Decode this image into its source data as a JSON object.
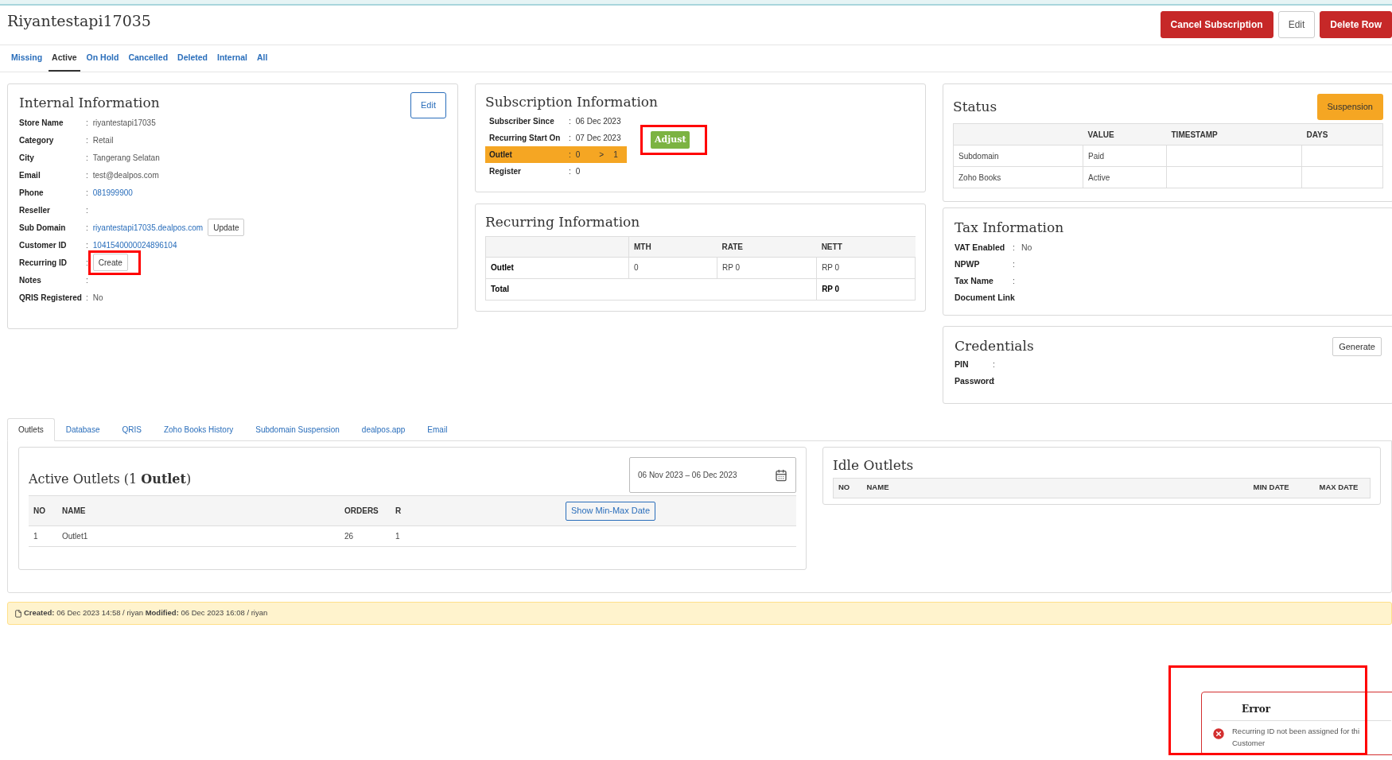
{
  "page": {
    "title": "Riyantestapi17035",
    "actions": [
      {
        "label": "Cancel Subscription",
        "kind": "danger"
      },
      {
        "label": "Edit",
        "kind": "outline"
      },
      {
        "label": "Delete Row",
        "kind": "danger"
      }
    ]
  },
  "filter_tabs": [
    {
      "label": "Missing",
      "selected": false
    },
    {
      "label": "Active",
      "selected": true
    },
    {
      "label": "On Hold",
      "selected": false
    },
    {
      "label": "Cancelled",
      "selected": false
    },
    {
      "label": "Deleted",
      "selected": false
    },
    {
      "label": "Internal",
      "selected": false
    },
    {
      "label": "All",
      "selected": false
    }
  ],
  "internal_information": {
    "title": "Internal Information",
    "edit_button": "Edit",
    "fields": [
      {
        "label": "Store Name",
        "sep": ":",
        "value": "riyantestapi17035",
        "kind": "text"
      },
      {
        "label": "Category",
        "sep": ":",
        "value": "Retail",
        "kind": "text"
      },
      {
        "label": "City",
        "sep": ":",
        "value": "Tangerang Selatan",
        "kind": "text"
      },
      {
        "label": "Email",
        "sep": ":",
        "value": "test@dealpos.com",
        "kind": "text"
      },
      {
        "label": "Phone",
        "sep": ":",
        "value": "081999900",
        "kind": "link"
      },
      {
        "label": "Reseller",
        "sep": ":"
      },
      {
        "label": "Sub Domain",
        "sep": ":",
        "value": "riyantestapi17035.dealpos.com",
        "kind": "link",
        "button": "Update"
      },
      {
        "label": "Customer ID",
        "sep": ":",
        "value": "1041540000024896104",
        "kind": "link"
      },
      {
        "label": "Recurring ID",
        "sep": ":",
        "kind": "button",
        "button": "Create",
        "annotated": true
      },
      {
        "label": "Notes",
        "sep": ":"
      },
      {
        "label": "QRIS Registered",
        "sep": ":",
        "value": "No",
        "kind": "text"
      }
    ]
  },
  "subscription_information": {
    "title": "Subscription Information",
    "fields": [
      {
        "label": "Subscriber Since",
        "sep": ":",
        "value": "06 Dec 2023",
        "highlighted": false
      },
      {
        "label": "Recurring Start On",
        "sep": ":",
        "value": "07 Dec 2023",
        "highlighted": false
      },
      {
        "label": "Outlet",
        "sep": ":",
        "value": "0",
        "arrow": ">",
        "target": "1",
        "highlighted": true
      },
      {
        "label": "Register",
        "sep": ":",
        "value": "0",
        "highlighted": false
      }
    ],
    "adjust_button": {
      "label": "Adjust",
      "annotated": true
    }
  },
  "recurring_information": {
    "title": "Recurring Information",
    "columns": [
      "MTH",
      "RATE",
      "NETT"
    ],
    "rows": [
      {
        "label": "Outlet",
        "cells": [
          "0",
          "RP 0",
          "RP 0"
        ]
      }
    ],
    "total": {
      "label": "Total",
      "value": "RP 0"
    }
  },
  "status": {
    "title": "Status",
    "button": "Suspension",
    "columns": [
      "VALUE",
      "TIMESTAMP",
      "DAYS"
    ],
    "rows": [
      {
        "name": "Subdomain",
        "value": "Paid"
      },
      {
        "name": "Zoho Books",
        "value": "Active"
      }
    ]
  },
  "tax_information": {
    "title": "Tax Information",
    "fields": [
      {
        "label": "VAT Enabled",
        "sep": ":",
        "value": "No"
      },
      {
        "label": "NPWP",
        "sep": ":"
      },
      {
        "label": "Tax Name",
        "sep": ":"
      },
      {
        "label": "Document Link",
        "sep": ":"
      }
    ]
  },
  "credentials": {
    "title": "Credentials",
    "button": "Generate",
    "fields": [
      {
        "label": "PIN",
        "sep": ":"
      },
      {
        "label": "Password",
        "sep": ":"
      }
    ]
  },
  "detail_tabs": [
    {
      "label": "Outlets",
      "selected": true
    },
    {
      "label": "Database",
      "selected": false
    },
    {
      "label": "QRIS",
      "selected": false
    },
    {
      "label": "Zoho Books History",
      "selected": false
    },
    {
      "label": "Subdomain Suspension",
      "selected": false
    },
    {
      "label": "dealpos.app",
      "selected": false
    },
    {
      "label": "Email",
      "selected": false
    }
  ],
  "active_outlets": {
    "title": "Active Outlets (1 **Outlet**)",
    "date_range": "06 Nov 2023 – 06 Dec 2023",
    "columns": [
      "NO",
      "NAME",
      "ORDERS",
      "R"
    ],
    "header_button": "Show Min-Max Date",
    "rows": [
      [
        "1",
        "Outlet1",
        "26",
        "1"
      ]
    ]
  },
  "idle_outlets": {
    "title": "Idle Outlets",
    "columns": [
      "NO",
      "NAME",
      "MIN DATE",
      "MAX DATE"
    ]
  },
  "footer": "**Created:** 06 Dec 2023 14:58 / riyan **Modified:** 06 Dec 2023 16:08 / riyan",
  "toast": {
    "title": "Error",
    "message_lines": [
      "Recurring ID not been assigned for thi",
      "Customer"
    ],
    "annotated": true
  }
}
